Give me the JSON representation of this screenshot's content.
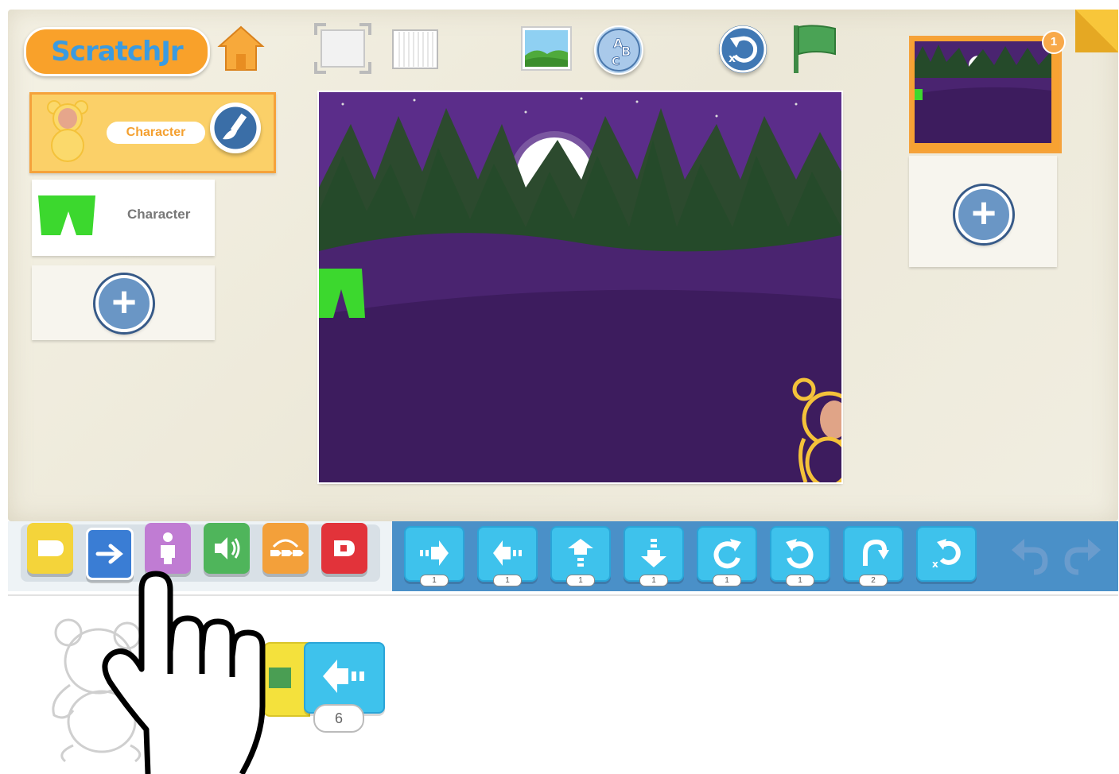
{
  "app": {
    "name": "ScratchJr"
  },
  "toolbar": {
    "logo_text": "ScratchJr",
    "icons": [
      "home-icon",
      "full-screen-icon",
      "grid-icon",
      "change-background-icon",
      "add-text-icon",
      "reset-characters-icon",
      "green-flag-icon"
    ]
  },
  "sprites": {
    "items": [
      {
        "label": "Character",
        "selected": true
      },
      {
        "label": "Character",
        "selected": false
      }
    ],
    "add_label": "+"
  },
  "pages": {
    "count_badge": "1",
    "add_label": "+"
  },
  "categories": [
    {
      "name": "triggering",
      "color": "#f4d43a"
    },
    {
      "name": "motion",
      "color": "#3a7dd4"
    },
    {
      "name": "looks",
      "color": "#c07cd3"
    },
    {
      "name": "sound",
      "color": "#4fb55b"
    },
    {
      "name": "control",
      "color": "#f3a03a"
    },
    {
      "name": "end",
      "color": "#e2333a"
    }
  ],
  "motion_blocks": [
    {
      "name": "move-right",
      "value": "1"
    },
    {
      "name": "move-left",
      "value": "1"
    },
    {
      "name": "move-up",
      "value": "1"
    },
    {
      "name": "move-down",
      "value": "1"
    },
    {
      "name": "turn-right",
      "value": "1"
    },
    {
      "name": "turn-left",
      "value": "1"
    },
    {
      "name": "hop",
      "value": "2"
    },
    {
      "name": "go-home",
      "value": ""
    }
  ],
  "script": {
    "move_left_value": "6"
  },
  "colors": {
    "stage_sky": "#5b2d8a",
    "motion_block": "#3ec2ec",
    "palette_bar": "#4a90c8"
  }
}
